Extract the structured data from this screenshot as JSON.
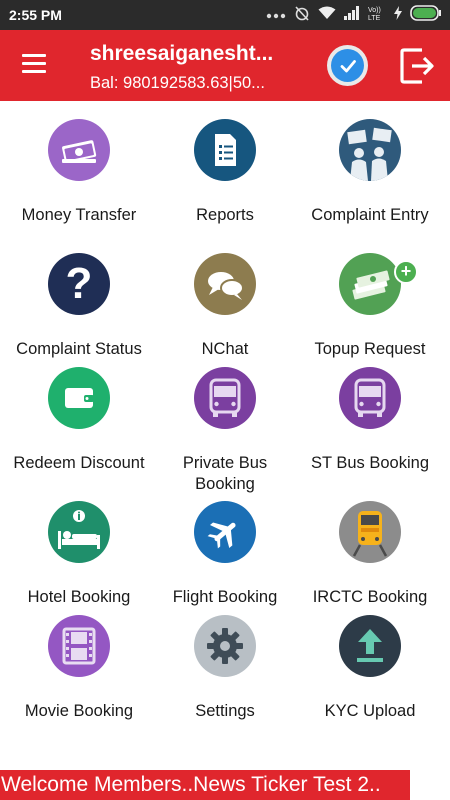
{
  "status_bar": {
    "time": "2:55 PM",
    "icons": [
      "more-dots-icon",
      "alarm-off-icon",
      "wifi-icon",
      "signal-icon",
      "volte-icon",
      "charging-icon",
      "battery-icon"
    ]
  },
  "header": {
    "title": "shreesaiganesht...",
    "balance": "Bal: 980192583.63|50...",
    "colors": {
      "bar": "#e0262d",
      "check": "#2d8fe6"
    }
  },
  "tiles": [
    {
      "label": "Money Transfer",
      "icon": "money-transfer-icon",
      "color": "#9b66c8"
    },
    {
      "label": "Reports",
      "icon": "reports-icon",
      "color": "#16567f"
    },
    {
      "label": "Complaint Entry",
      "icon": "complaint-entry-icon",
      "color": "#2f5a7c"
    },
    {
      "label": "Complaint Status",
      "icon": "question-icon",
      "color": "#1f2e55"
    },
    {
      "label": "NChat",
      "icon": "chat-icon",
      "color": "#8d7c4f"
    },
    {
      "label": "Topup Request",
      "icon": "topup-money-icon",
      "color": "#52a154"
    },
    {
      "label": "Redeem Discount",
      "icon": "wallet-icon",
      "color": "#1fb06d"
    },
    {
      "label": "Private Bus Booking",
      "icon": "private-bus-icon",
      "color": "#7b3fa0"
    },
    {
      "label": "ST Bus Booking",
      "icon": "st-bus-icon",
      "color": "#7b3fa0"
    },
    {
      "label": "Hotel Booking",
      "icon": "hotel-icon",
      "color": "#1f8f6b"
    },
    {
      "label": "Flight Booking",
      "icon": "flight-icon",
      "color": "#1b6fb5"
    },
    {
      "label": "IRCTC Booking",
      "icon": "train-icon",
      "color": "#8c8c8c"
    },
    {
      "label": "Movie Booking",
      "icon": "movie-film-icon",
      "color": "#9457c3"
    },
    {
      "label": "Settings",
      "icon": "settings-gear-icon",
      "color": "#b8bfc5"
    },
    {
      "label": "KYC Upload",
      "icon": "upload-icon",
      "color": "#2d3b48"
    }
  ],
  "ticker": {
    "text": "Welcome Members..News Ticker Test 2.."
  }
}
